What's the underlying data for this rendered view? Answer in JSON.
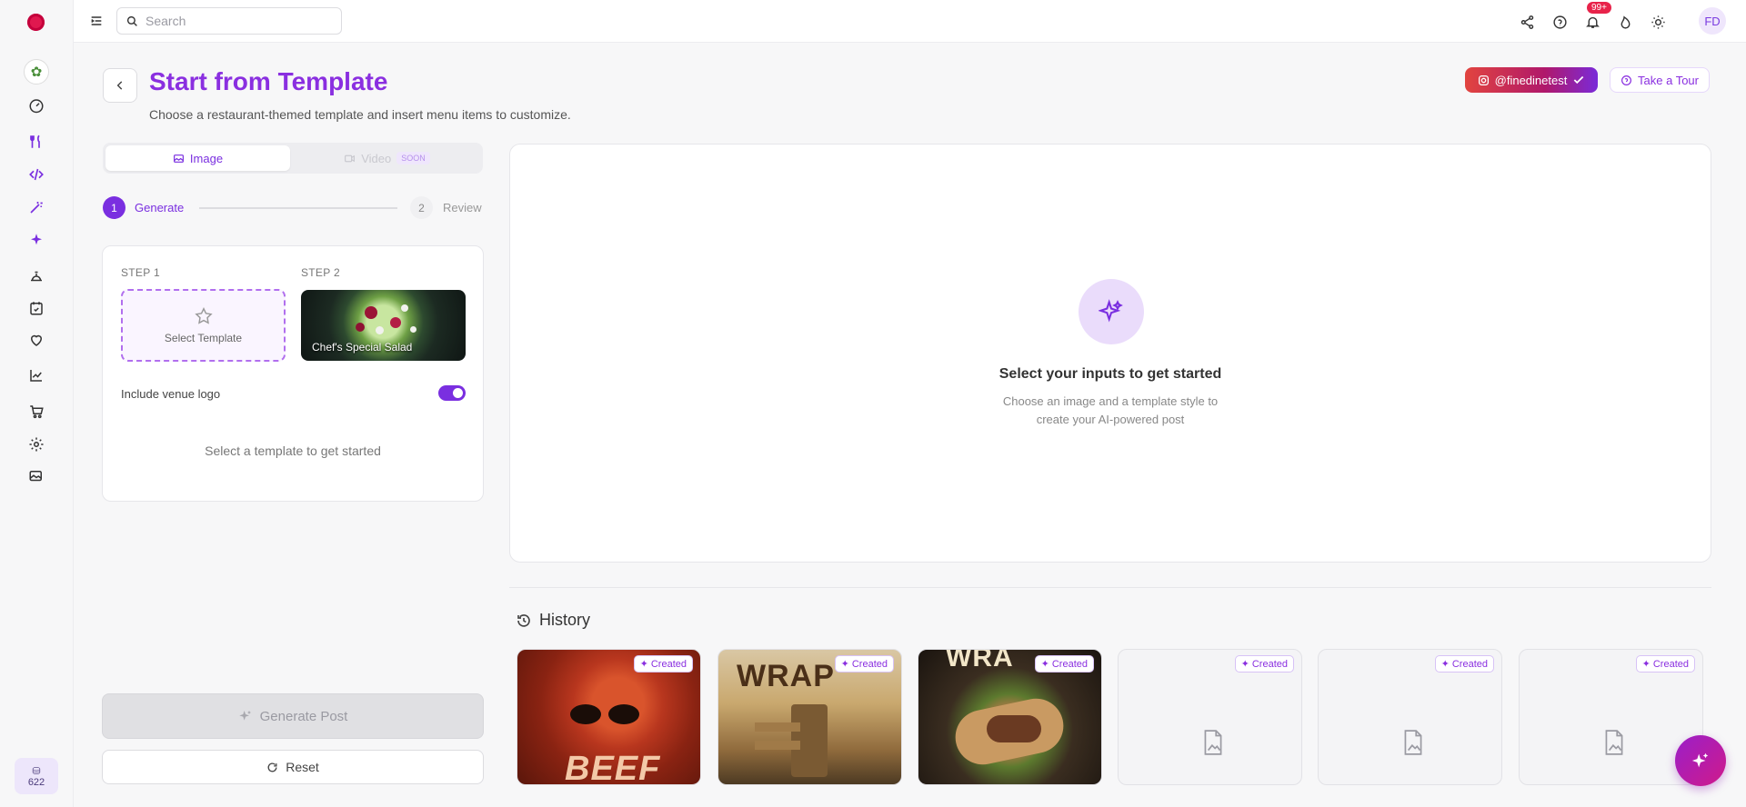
{
  "colors": {
    "accent": "#7a2fe0",
    "title": "#8a2fe0",
    "brand_dot": "#e0184f"
  },
  "sidebar": {
    "items": [
      {
        "icon": "dashboard-gauge-icon"
      },
      {
        "icon": "fork-knife-icon"
      },
      {
        "icon": "code-icon"
      },
      {
        "icon": "magic-wand-icon"
      },
      {
        "icon": "sparkles-icon"
      },
      {
        "icon": "bell-service-icon"
      },
      {
        "icon": "calendar-check-icon"
      },
      {
        "icon": "heart-icon"
      },
      {
        "icon": "chart-line-icon"
      },
      {
        "icon": "cart-icon"
      },
      {
        "icon": "gear-icon"
      },
      {
        "icon": "images-icon"
      }
    ],
    "credits": "622"
  },
  "topbar": {
    "search_placeholder": "Search",
    "notifications_count": "99+",
    "avatar_initials": "FD"
  },
  "header": {
    "title": "Start from Template",
    "subtitle": "Choose a restaurant-themed template and insert menu items to customize.",
    "instagram_handle": "@finedinetest",
    "tour_label": "Take a Tour"
  },
  "media_tabs": {
    "image": "Image",
    "video": "Video",
    "video_badge": "SOON"
  },
  "stepper": [
    {
      "num": "1",
      "label": "Generate"
    },
    {
      "num": "2",
      "label": "Review"
    }
  ],
  "config": {
    "step1_label": "STEP 1",
    "step2_label": "STEP 2",
    "select_template": "Select Template",
    "dish_name": "Chef's Special Salad",
    "include_logo": "Include venue logo",
    "hint": "Select a template to get started"
  },
  "actions": {
    "generate": "Generate Post",
    "reset": "Reset"
  },
  "preview": {
    "title": "Select your inputs to get started",
    "subtitle_line1": "Choose an image and a template style to",
    "subtitle_line2": "create your AI-powered post"
  },
  "history": {
    "title": "History",
    "badge": "Created",
    "thumb_texts": [
      "BEEF",
      "WRAP",
      "WRA"
    ]
  }
}
